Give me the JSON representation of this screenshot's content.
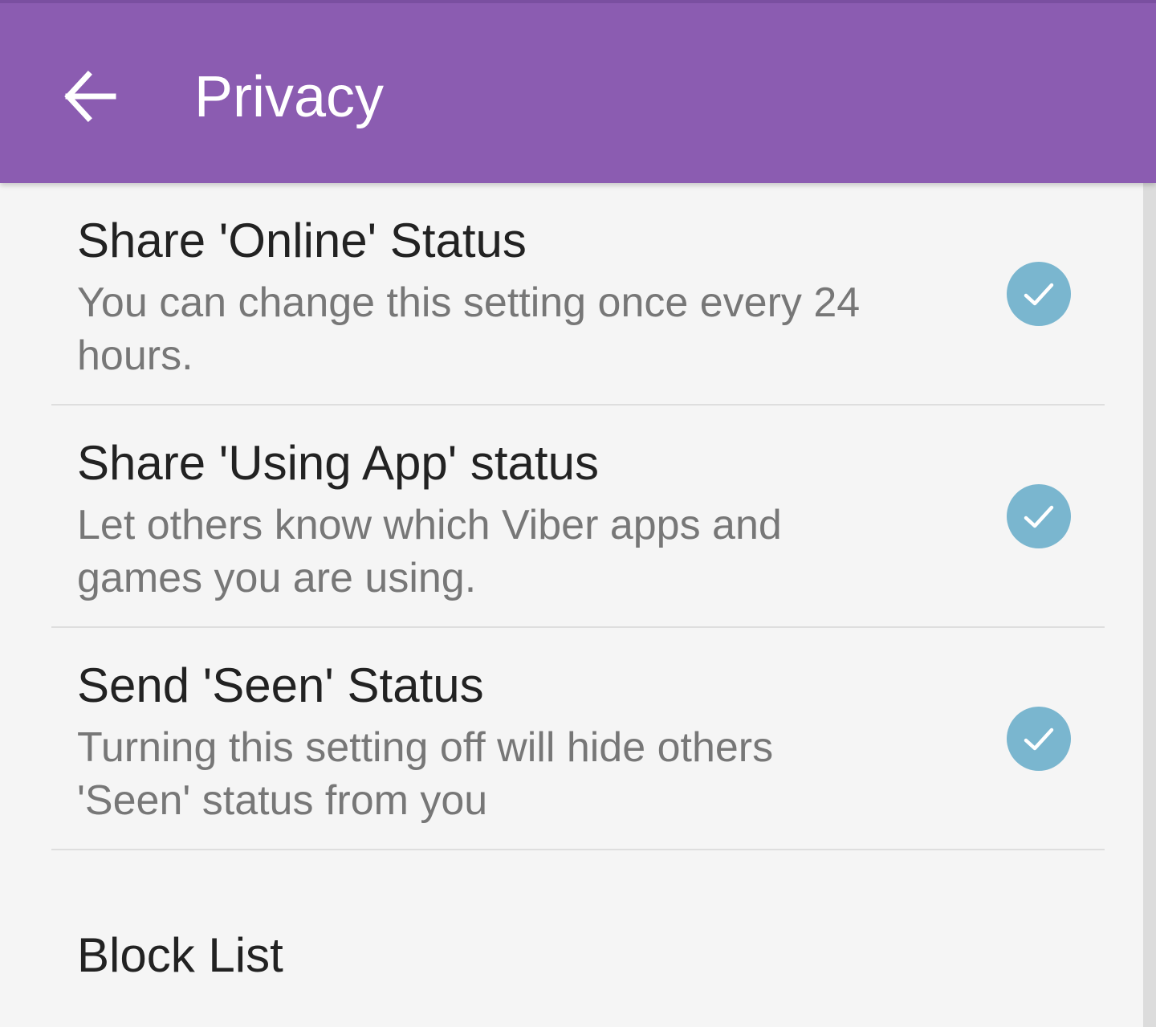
{
  "header": {
    "title": "Privacy",
    "back_icon": "arrow-left-icon",
    "background": "#8b5cb1"
  },
  "settings": [
    {
      "title": "Share 'Online' Status",
      "subtitle": "You can change this setting once every 24 hours.",
      "checked": true
    },
    {
      "title": "Share 'Using App' status",
      "subtitle": "Let others know which Viber apps and games you are using.",
      "checked": true
    },
    {
      "title": "Send 'Seen' Status",
      "subtitle": "Turning this setting off will hide others 'Seen' status from you",
      "checked": true
    }
  ],
  "block_list": {
    "title": "Block List"
  },
  "colors": {
    "checkbox": "#7ab6cf",
    "title_text": "#222222",
    "subtitle_text": "#777777"
  }
}
